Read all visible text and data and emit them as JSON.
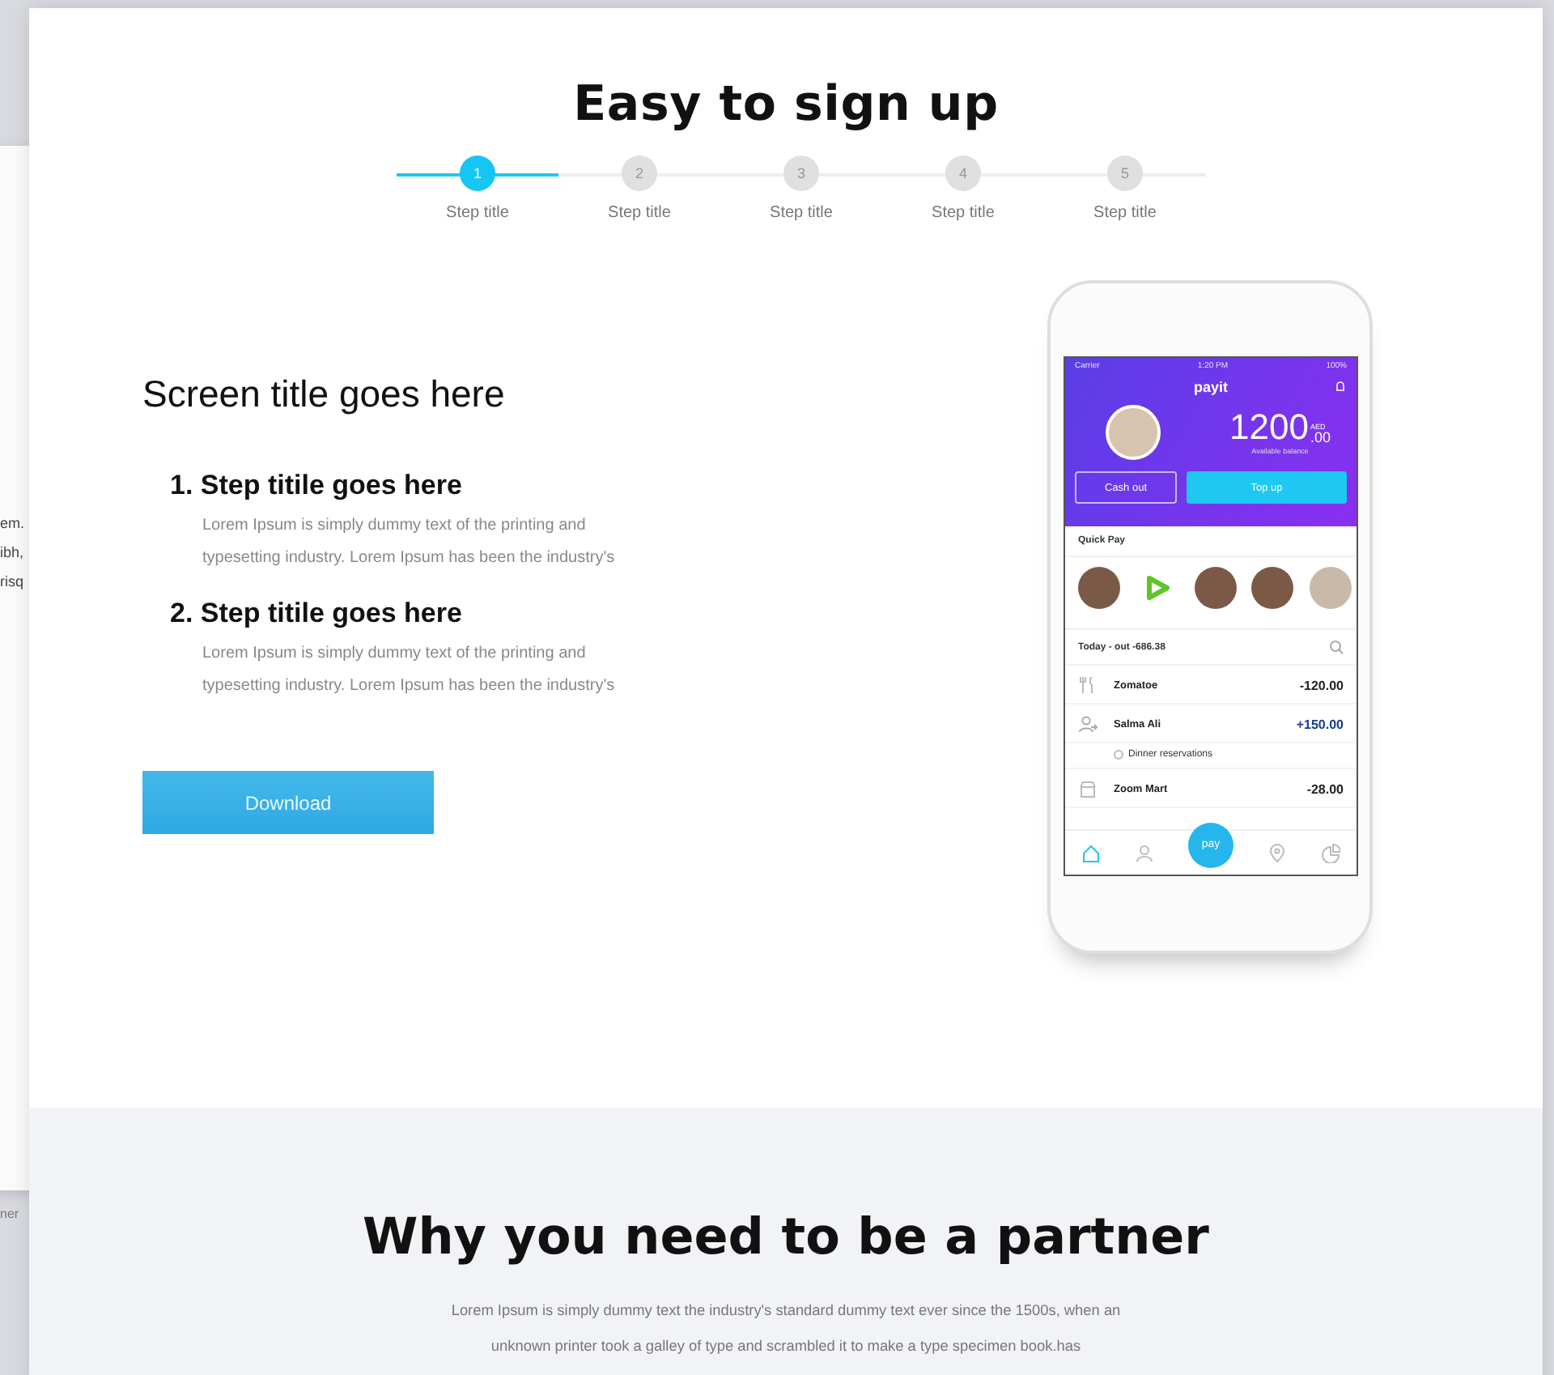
{
  "background_page": {
    "fragments": [
      "em.",
      "ibh,",
      "risq",
      "ner"
    ]
  },
  "header": {
    "title": "Easy to sign up"
  },
  "stepper": [
    {
      "number": "1",
      "label": "Step title",
      "selected": true
    },
    {
      "number": "2",
      "label": "Step title",
      "selected": false
    },
    {
      "number": "3",
      "label": "Step title",
      "selected": false
    },
    {
      "number": "4",
      "label": "Step title",
      "selected": false
    },
    {
      "number": "5",
      "label": "Step title",
      "selected": false
    }
  ],
  "screen": {
    "title": "Screen title goes here",
    "steps": [
      {
        "title": "1. Step titile goes here",
        "body": "Lorem Ipsum is simply dummy text of the printing and typesetting industry. Lorem Ipsum has been the industry's"
      },
      {
        "title": "2. Step titile goes here",
        "body": "Lorem Ipsum is simply dummy text of the printing and typesetting industry. Lorem Ipsum has been the industry's"
      }
    ],
    "button": "Download"
  },
  "phone": {
    "status": {
      "carrier": "Carrier",
      "time": "1:20 PM",
      "battery": "100%"
    },
    "brand": "payit",
    "balance": {
      "amount": "1200",
      "currency": "AED",
      "decimals": ".00",
      "caption": "Available balance"
    },
    "actions": [
      {
        "label": "Cash out",
        "kind": "outline"
      },
      {
        "label": "Top up",
        "kind": "filled"
      }
    ],
    "quick_pay": "Quick Pay",
    "today": "Today - out -686.38",
    "transactions": [
      {
        "name": "Zomatoe",
        "amount": "-120.00",
        "kind": "food"
      },
      {
        "name": "Salma Ali",
        "amount": "+150.00",
        "kind": "transfer",
        "note": "Dinner reservations"
      },
      {
        "name": "Zoom Mart",
        "amount": "-28.00",
        "kind": "shop"
      }
    ],
    "pay_button": "pay"
  },
  "partner": {
    "title": "Why you need to be a partner",
    "body": "Lorem Ipsum is simply dummy text the industry's standard dummy text ever since the 1500s, when an unknown printer took a galley of type and scrambled it to make a type specimen book.has"
  }
}
